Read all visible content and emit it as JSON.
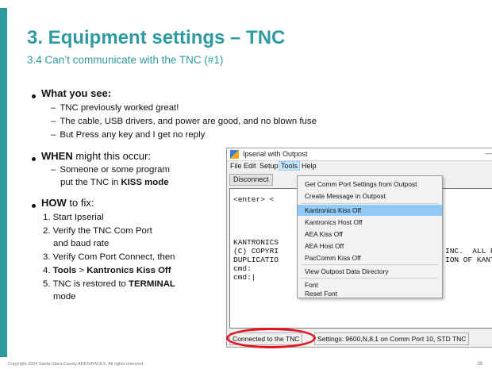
{
  "slide": {
    "title": "3. Equipment settings – TNC",
    "subtitle": "3.4 Can’t communicate with the TNC (#1)",
    "see_heading": "What you see:",
    "see_items": [
      "TNC previously worked great!",
      "The cable, USB drivers, and power are good, and no blown fuse",
      "But Press any key and I get no reply"
    ],
    "when_bold": "WHEN",
    "when_rest": " might this occur:",
    "when_line1": "Someone or some program",
    "when_line2_pre": "put the TNC in ",
    "when_line2_bold": "KISS mode",
    "how_bold": "HOW",
    "how_rest": " to fix:",
    "steps": {
      "s1": "1. Start Ipserial",
      "s2a": "2. Verify the TNC Com Port",
      "s2b": "and baud rate",
      "s3": "3. Verify Com Port Connect, then",
      "s4_num": "4. ",
      "s4_tools": "Tools",
      "s4_gt": " > ",
      "s4_kiss": "Kantronics Kiss Off",
      "s5_pre": "5. TNC is restored to ",
      "s5_bold": "TERMINAL",
      "s5_end": "mode"
    },
    "footer": "Copyright 2024 Santa Clara County ARES/RACES.  All rights reserved.",
    "page_number": "39"
  },
  "window": {
    "title": "Ipserial with Outpost",
    "menu": [
      "File",
      "Edit",
      "Setup",
      "Tools",
      "Help"
    ],
    "disconnect_label": "Disconnect",
    "terminal": {
      "line_enter": "<enter> <",
      "line_kantronics": "KANTRONICS",
      "line_copyright": "(C) COPYRI",
      "line_duplication": "DUPLICATIO",
      "line_cmd1": "cmd:",
      "line_cmd2": "cmd:|",
      "right_inc": "INC.  ALL R",
      "right_ion": "ION OF KANT"
    },
    "status_connected": "Connected to the TNC",
    "status_settings": "Settings: 9600,N,8,1 on Comm Port 10, STD TNC"
  },
  "tools_menu": {
    "items": [
      "Get Comm Port Settings from Outpost",
      "Create Message in Outpost",
      "Kantronics Kiss Off",
      "Kantronics Host Off",
      "AEA Kiss Off",
      "AEA Host Off",
      "PacComm Kiss Off",
      "View Outpost Data Directory",
      "Font",
      "Reset Font"
    ],
    "highlighted": "Kantronics Kiss Off"
  },
  "colors": {
    "accent": "#2f9aa0",
    "highlight_ring": "#e2141f",
    "menu_highlight": "#91c9f7"
  }
}
